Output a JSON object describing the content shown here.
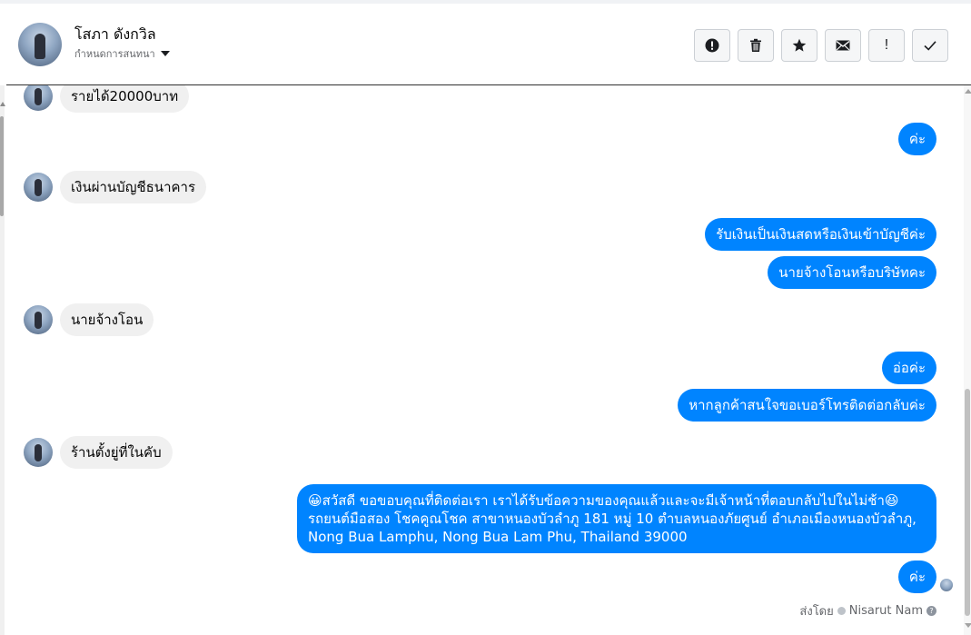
{
  "header": {
    "contact_name": "โสภา ดังกวิล",
    "conversation_settings": "กำหนดการสนทนา",
    "actions": [
      {
        "name": "report-button",
        "icon": "alert-circle-icon",
        "label": ""
      },
      {
        "name": "delete-button",
        "icon": "trash-icon",
        "label": ""
      },
      {
        "name": "star-button",
        "icon": "star-icon",
        "label": ""
      },
      {
        "name": "mark-unread-button",
        "icon": "envelope-icon",
        "label": ""
      },
      {
        "name": "follow-up-button",
        "icon": "exclamation-icon",
        "label": "!"
      },
      {
        "name": "mark-done-button",
        "icon": "check-icon",
        "label": ""
      }
    ]
  },
  "messages": [
    {
      "dir": "in",
      "text": "รายได้20000บาท"
    },
    {
      "dir": "out",
      "text": "ค่ะ"
    },
    {
      "dir": "in",
      "text": "เงินผ่านบัญชีธนาคาร"
    },
    {
      "dir": "out",
      "text": "รับเงินเป็นเงินสดหรือเงินเข้าบัญชีค่ะ"
    },
    {
      "dir": "out",
      "text": "นายจ้างโอนหรือบริษัทคะ"
    },
    {
      "dir": "in",
      "text": "นายจ้างโอน"
    },
    {
      "dir": "out",
      "text": "อ่อค่ะ"
    },
    {
      "dir": "out",
      "text": "หากลูกค้าสนใจขอเบอร์โทรติดต่อกลับค่ะ"
    },
    {
      "dir": "in",
      "text": "ร้านตั้งยู่ที่ในคับ"
    },
    {
      "dir": "out",
      "text_lines": [
        "😀สวัสดี ขอขอบคุณที่ติดต่อเรา เราได้รับข้อความของคุณแล้วและจะมีเจ้าหน้าที่ตอบกลับไปในไม่ช้า😆",
        "รถยนต์มือสอง โชคคูณโชค สาขาหนองบัวลำภู 181 หมู่ 10  ตำบลหนองภัยศูนย์  อำเภอเมืองหนองบัวลำภู,",
        "Nong Bua Lamphu, Nong Bua Lam Phu, Thailand 39000"
      ]
    },
    {
      "dir": "out",
      "text": "ค่ะ"
    }
  ],
  "footer": {
    "sent_by_prefix": "ส่งโดย",
    "sent_by_name": "Nisarut Nam"
  },
  "colors": {
    "outgoing_bubble": "#0084ff",
    "incoming_bubble": "#f0f0f0"
  }
}
